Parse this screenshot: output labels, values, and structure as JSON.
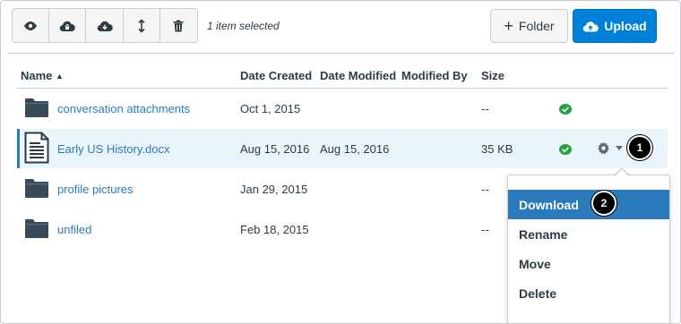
{
  "toolbar": {
    "buttons": [
      {
        "icon": "eye-icon",
        "name": "preview-button"
      },
      {
        "icon": "cloud-lock-icon",
        "name": "restrict-access-button"
      },
      {
        "icon": "cloud-download-icon",
        "name": "download-button"
      },
      {
        "icon": "move-arrows-icon",
        "name": "move-button"
      },
      {
        "icon": "trash-icon",
        "name": "delete-button"
      }
    ],
    "selection_text": "1 item selected",
    "folder_label": "Folder",
    "folder_prefix": "+",
    "upload_label": "Upload"
  },
  "table": {
    "headers": {
      "name": "Name",
      "date_created": "Date Created",
      "date_modified": "Date Modified",
      "modified_by": "Modified By",
      "size": "Size"
    },
    "sort_indicator": "▲",
    "rows": [
      {
        "type": "folder",
        "name": "conversation attachments",
        "date_created": "Oct 1, 2015",
        "date_modified": "",
        "modified_by": "",
        "size": "--",
        "published": true
      },
      {
        "type": "document",
        "name": "Early US History.docx",
        "date_created": "Aug 15, 2016",
        "date_modified": "Aug 15, 2016",
        "modified_by": "",
        "size": "35 KB",
        "published": true,
        "selected": true
      },
      {
        "type": "folder",
        "name": "profile pictures",
        "date_created": "Jan 29, 2015",
        "date_modified": "",
        "modified_by": "",
        "size": "--"
      },
      {
        "type": "folder",
        "name": "unfiled",
        "date_created": "Feb 18, 2015",
        "date_modified": "",
        "modified_by": "",
        "size": "--"
      }
    ]
  },
  "menu": {
    "items": [
      "Download",
      "Rename",
      "Move",
      "Delete"
    ],
    "active": "Download"
  },
  "badges": [
    "1",
    "2"
  ],
  "colors": {
    "accent": "#2b7abc",
    "upload_bg": "#0081d9",
    "published_green": "#24a141",
    "selected_row_bg": "#eaf4fb"
  }
}
